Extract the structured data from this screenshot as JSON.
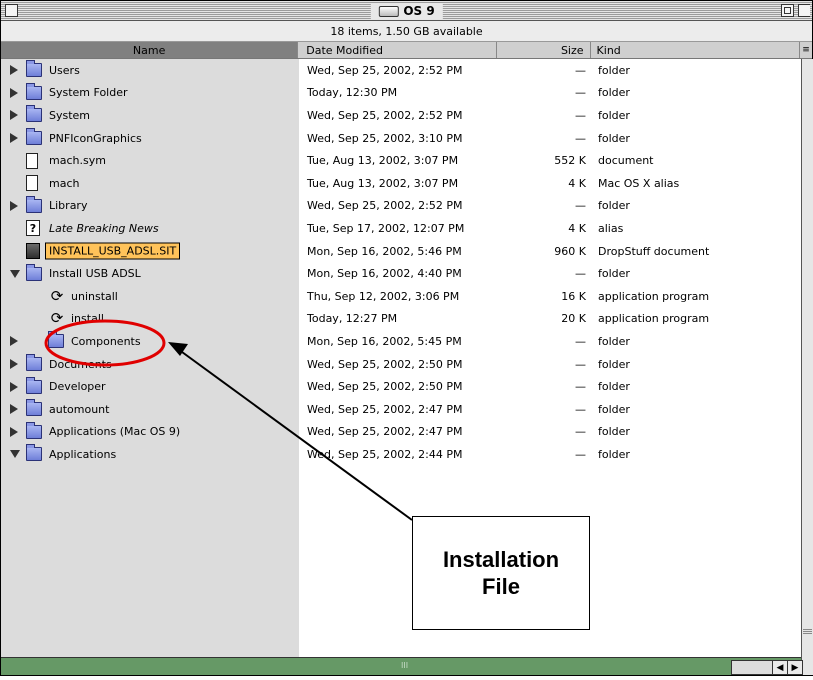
{
  "window": {
    "title": "OS 9",
    "info": "18 items, 1.50 GB available",
    "scroll_thumb": "III"
  },
  "columns": {
    "name": "Name",
    "date": "Date Modified",
    "size": "Size",
    "kind": "Kind"
  },
  "colors": {
    "highlight": "#ffc35a",
    "annotation_red": "#e00000",
    "status_green": "#669966",
    "sorted_column": "#808080"
  },
  "rows": [
    {
      "name": "Users",
      "date": "Wed, Sep 25, 2002, 2:52 PM",
      "size": "—",
      "kind": "folder",
      "icon": "users-folder-icon",
      "triangle": "right",
      "level": 0
    },
    {
      "name": "System Folder",
      "date": "Today, 12:30 PM",
      "size": "—",
      "kind": "folder",
      "icon": "system-folder-icon",
      "triangle": "right",
      "level": 0
    },
    {
      "name": "System",
      "date": "Wed, Sep 25, 2002, 2:52 PM",
      "size": "—",
      "kind": "folder",
      "icon": "folder-icon",
      "triangle": "right",
      "level": 0
    },
    {
      "name": "PNFIconGraphics",
      "date": "Wed, Sep 25, 2002, 3:10 PM",
      "size": "—",
      "kind": "folder",
      "icon": "folder-icon",
      "triangle": "right",
      "level": 0
    },
    {
      "name": "mach.sym",
      "date": "Tue, Aug 13, 2002, 3:07 PM",
      "size": "552 K",
      "kind": "document",
      "icon": "document-icon",
      "triangle": "",
      "level": 0
    },
    {
      "name": "mach",
      "date": "Tue, Aug 13, 2002, 3:07 PM",
      "size": "4 K",
      "kind": "Mac OS X alias",
      "icon": "document-icon",
      "triangle": "",
      "level": 0
    },
    {
      "name": "Library",
      "date": "Wed, Sep 25, 2002, 2:52 PM",
      "size": "—",
      "kind": "folder",
      "icon": "folder-icon",
      "triangle": "right",
      "level": 0
    },
    {
      "name": "Late Breaking News",
      "date": "Tue, Sep 17, 2002, 12:07 PM",
      "size": "4 K",
      "kind": "alias",
      "icon": "alias-icon",
      "triangle": "",
      "level": 0,
      "italic": true
    },
    {
      "name": "INSTALL_USB_ADSL.SIT",
      "date": "Mon, Sep 16, 2002, 5:46 PM",
      "size": "960 K",
      "kind": "DropStuff document",
      "icon": "stuffit-icon",
      "triangle": "",
      "level": 0,
      "highlight": true
    },
    {
      "name": "Install USB ADSL",
      "date": "Mon, Sep 16, 2002, 4:40 PM",
      "size": "—",
      "kind": "folder",
      "icon": "folder-icon",
      "triangle": "down",
      "level": 0
    },
    {
      "name": "uninstall",
      "date": "Thu, Sep 12, 2002, 3:06 PM",
      "size": "16 K",
      "kind": "application program",
      "icon": "installer-icon",
      "triangle": "",
      "level": 1
    },
    {
      "name": "install",
      "date": "Today, 12:27 PM",
      "size": "20 K",
      "kind": "application program",
      "icon": "installer-icon",
      "triangle": "",
      "level": 1
    },
    {
      "name": "Components",
      "date": "Mon, Sep 16, 2002, 5:45 PM",
      "size": "—",
      "kind": "folder",
      "icon": "folder-icon",
      "triangle": "right",
      "level": 1
    },
    {
      "name": "Documents",
      "date": "Wed, Sep 25, 2002, 2:50 PM",
      "size": "—",
      "kind": "folder",
      "icon": "documents-folder-icon",
      "triangle": "right",
      "level": 0
    },
    {
      "name": "Developer",
      "date": "Wed, Sep 25, 2002, 2:50 PM",
      "size": "—",
      "kind": "folder",
      "icon": "folder-icon",
      "triangle": "right",
      "level": 0
    },
    {
      "name": "automount",
      "date": "Wed, Sep 25, 2002, 2:47 PM",
      "size": "—",
      "kind": "folder",
      "icon": "folder-icon",
      "triangle": "right",
      "level": 0
    },
    {
      "name": "Applications (Mac OS 9)",
      "date": "Wed, Sep 25, 2002, 2:47 PM",
      "size": "—",
      "kind": "folder",
      "icon": "applications-folder-icon",
      "triangle": "right",
      "level": 0
    },
    {
      "name": "Applications",
      "date": "Wed, Sep 25, 2002, 2:44 PM",
      "size": "—",
      "kind": "folder",
      "icon": "folder-icon",
      "triangle": "down",
      "level": 0
    }
  ],
  "annotation": {
    "line1": "Installation",
    "line2": "File"
  }
}
